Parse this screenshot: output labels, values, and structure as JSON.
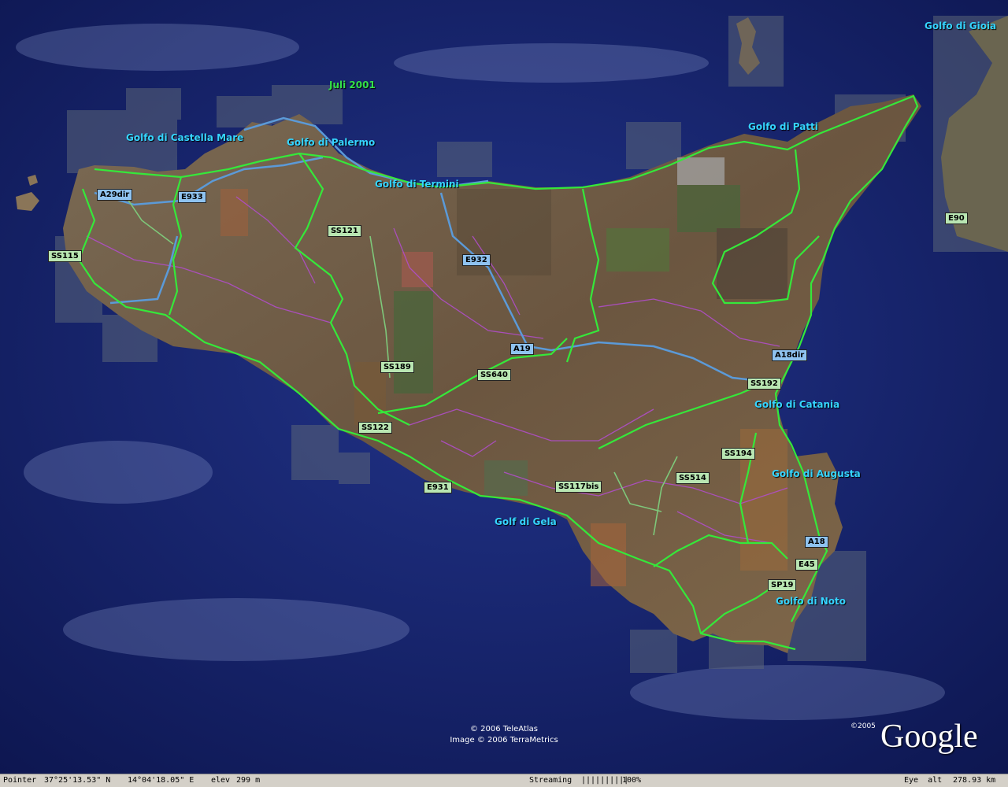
{
  "map": {
    "overlay_date": "Juli 2001",
    "water_labels": [
      {
        "id": "golfo-di-gioia",
        "text": "Golfo di Gioia"
      },
      {
        "id": "golfo-di-castella-mare",
        "text": "Golfo di Castella Mare"
      },
      {
        "id": "golfo-di-palermo",
        "text": "Golfo di Palermo"
      },
      {
        "id": "golfo-di-termini",
        "text": "Golfo di Termini"
      },
      {
        "id": "golfo-di-patti",
        "text": "Golfo di Patti"
      },
      {
        "id": "golfo-di-catania",
        "text": "Golfo di Catania"
      },
      {
        "id": "golfo-di-augusta",
        "text": "Golfo di Augusta"
      },
      {
        "id": "golf-di-gela",
        "text": "Golf di Gela"
      },
      {
        "id": "golfo-di-noto",
        "text": "Golfo di Noto"
      }
    ],
    "road_shields": [
      {
        "id": "a29dir",
        "text": "A29dir",
        "kind": "blue"
      },
      {
        "id": "e933",
        "text": "E933",
        "kind": "blue"
      },
      {
        "id": "ss115",
        "text": "SS115",
        "kind": "green"
      },
      {
        "id": "ss121",
        "text": "SS121",
        "kind": "green"
      },
      {
        "id": "e932",
        "text": "E932",
        "kind": "blue"
      },
      {
        "id": "e90",
        "text": "E90",
        "kind": "green"
      },
      {
        "id": "a19",
        "text": "A19",
        "kind": "blue"
      },
      {
        "id": "ss189",
        "text": "SS189",
        "kind": "green"
      },
      {
        "id": "ss640",
        "text": "SS640",
        "kind": "green"
      },
      {
        "id": "a18dir",
        "text": "A18dir",
        "kind": "blue"
      },
      {
        "id": "ss192",
        "text": "SS192",
        "kind": "green"
      },
      {
        "id": "ss122",
        "text": "SS122",
        "kind": "green"
      },
      {
        "id": "ss194",
        "text": "SS194",
        "kind": "green"
      },
      {
        "id": "ss514",
        "text": "SS514",
        "kind": "green"
      },
      {
        "id": "e931",
        "text": "E931",
        "kind": "green"
      },
      {
        "id": "ss117bis",
        "text": "SS117bis",
        "kind": "green"
      },
      {
        "id": "a18",
        "text": "A18",
        "kind": "blue"
      },
      {
        "id": "e45",
        "text": "E45",
        "kind": "green"
      },
      {
        "id": "sp19",
        "text": "SP19",
        "kind": "green"
      }
    ],
    "credits": {
      "line1": "© 2006 TeleAtlas",
      "line2": "Image © 2006 TerraMetrics"
    },
    "logo": {
      "year": "©2005",
      "text": "Google"
    },
    "colors": {
      "sea": "#1a2a7a",
      "land": "#6e5b44",
      "major_road": "#35e83a",
      "highway": "#5b9ad8",
      "minor_road": "#b04ec8",
      "water_label": "#35d4ff"
    }
  },
  "status": {
    "pointer_label": "Pointer",
    "latitude": "37°25'13.53\" N",
    "longitude": "14°04'18.05\" E",
    "elev_label": "elev",
    "elevation": "299 m",
    "streaming_label": "Streaming",
    "streaming_bar": "||||||||||",
    "streaming_percent": "100%",
    "eye_alt_label": "Eye  alt",
    "eye_alt": "278.93 km"
  }
}
